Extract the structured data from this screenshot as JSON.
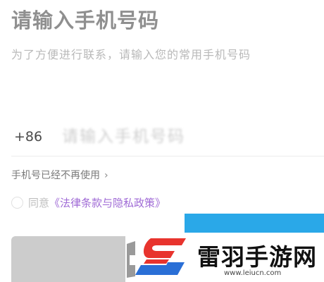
{
  "header": {
    "title": "请输入手机号码",
    "subtitle": "为了方便进行联系，请输入您的常用手机号码"
  },
  "phone": {
    "country_code": "+86",
    "placeholder": "请输入手机号码"
  },
  "links": {
    "no_longer_used": "手机号已经不再使用",
    "no_longer_icon": "chevron-right-icon"
  },
  "agreement": {
    "prefix": "同意",
    "policy_link": "《法律条款与隐私政策》",
    "checked": false
  },
  "watermark": {
    "text": "雷羽手游网",
    "url": "www.leiucn.com"
  },
  "colors": {
    "title": "#8f8f8f",
    "link_accent": "#a06bd6",
    "primary_blue": "#2aa8e8",
    "disabled_button": "#cccccc",
    "logo_red": "#e8342e",
    "logo_blue": "#2a6fd6"
  }
}
